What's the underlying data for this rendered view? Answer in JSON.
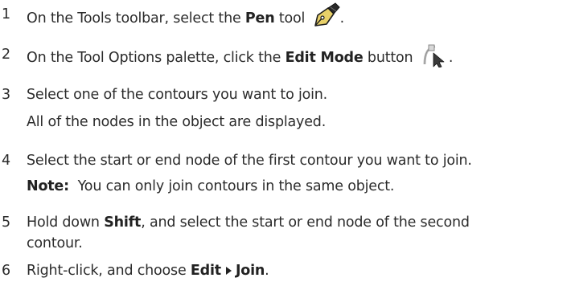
{
  "steps": [
    {
      "number": "1",
      "pre": "On the Tools toolbar, select the ",
      "bold": "Pen",
      "post": " tool",
      "end": ".",
      "icon": "pen-nib-icon"
    },
    {
      "number": "2",
      "pre": "On the Tool Options palette, click the ",
      "bold": "Edit Mode",
      "post": " button",
      "end": ".",
      "icon": "edit-mode-pointer-icon"
    },
    {
      "number": "3",
      "text": "Select one of the contours you want to join.",
      "sub": "All of the nodes in the object are displayed."
    },
    {
      "number": "4",
      "text": "Select the start or end node of the first contour you want to join.",
      "note_label": "Note:",
      "note_text": "You can only join contours in the same object."
    },
    {
      "number": "5",
      "pre": "Hold down ",
      "bold": "Shift",
      "post": ", and select the start or end node of the second",
      "cont": "contour."
    },
    {
      "number": "6",
      "pre": "Right-click, and choose ",
      "menu1": "Edit",
      "menu2": "Join",
      "end": "."
    }
  ],
  "colors": {
    "text": "#2b2b2b",
    "pen_icon_fill": "#e8d068",
    "edit_icon_fill": "#c9c9c9"
  }
}
